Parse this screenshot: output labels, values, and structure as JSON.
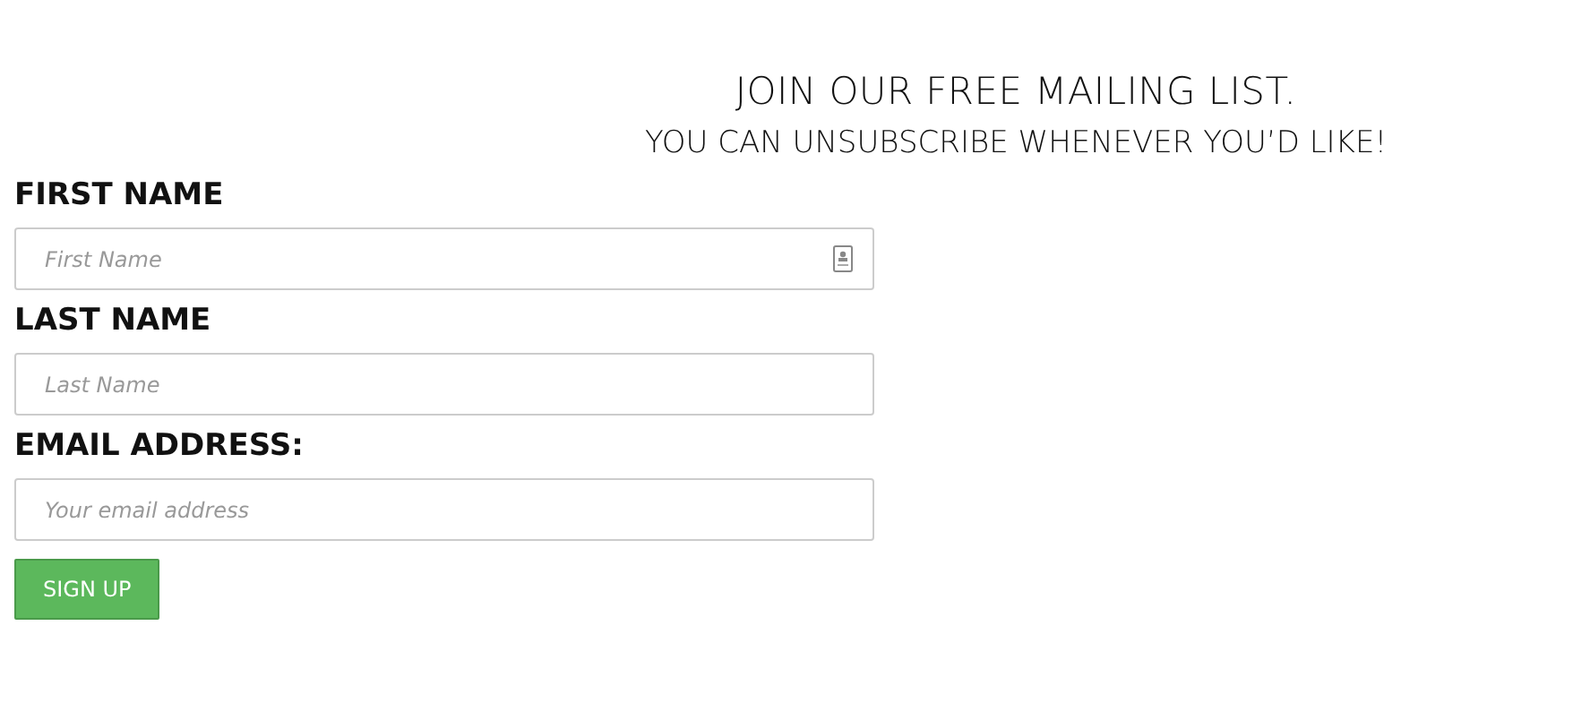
{
  "heading": {
    "title": "JOIN OUR FREE MAILING LIST.",
    "subtitle": "YOU CAN UNSUBSCRIBE WHENEVER YOU’D LIKE!"
  },
  "fields": [
    {
      "label": "FIRST NAME",
      "placeholder": "First Name",
      "autofill_icon": true
    },
    {
      "label": "LAST NAME",
      "placeholder": "Last Name",
      "autofill_icon": false
    },
    {
      "label": "EMAIL ADDRESS:",
      "placeholder": "Your email address",
      "autofill_icon": false
    }
  ],
  "button": "SIGN UP"
}
